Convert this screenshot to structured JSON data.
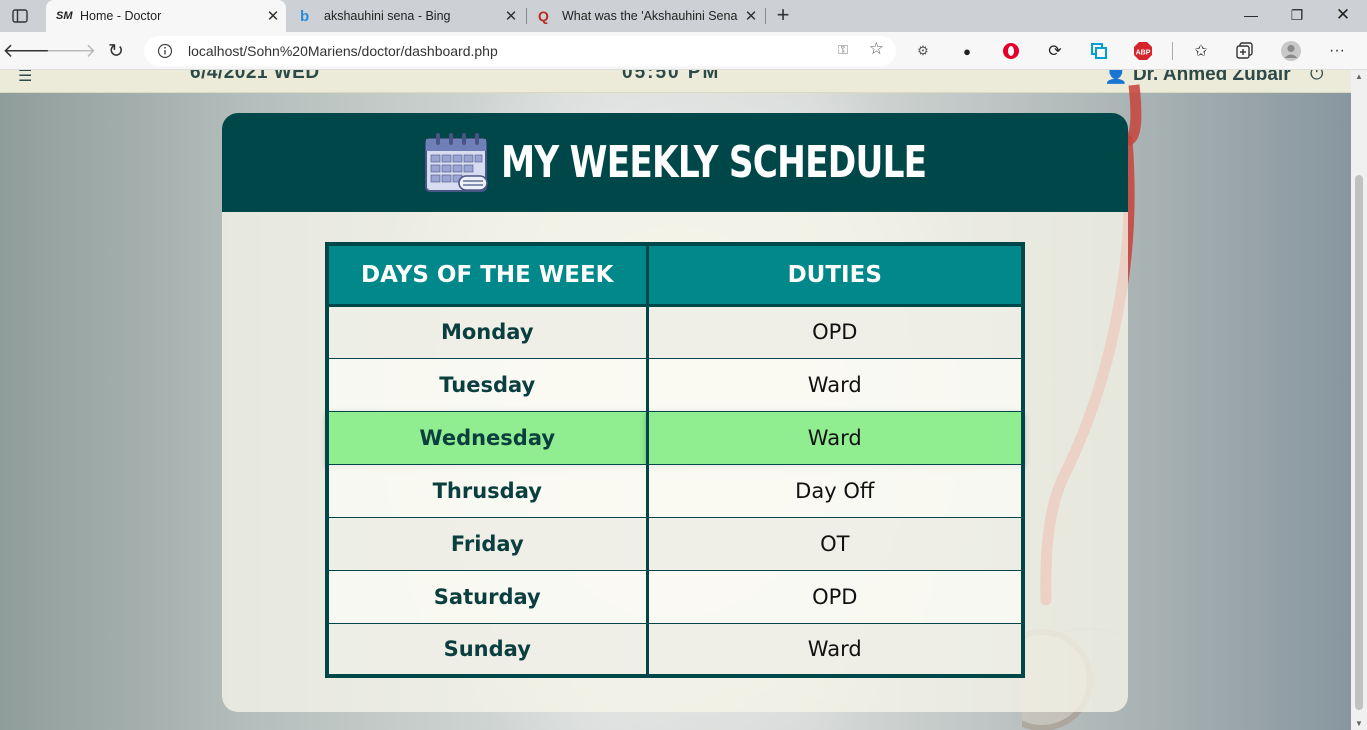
{
  "browser": {
    "tabs": [
      {
        "favicon_text": "SM",
        "title": "Home - Doctor",
        "active": true
      },
      {
        "favicon_text": "b",
        "title": "akshauhini sena - Bing",
        "active": false
      },
      {
        "favicon_text": "Q",
        "title": "What was the 'Akshauhini Sena' c",
        "active": false
      }
    ],
    "url": "localhost/Sohn%20Mariens/doctor/dashboard.php",
    "colors": {
      "bing_blue": "#2b8ed6",
      "quora_red": "#b92b27",
      "opera_red": "#e4002b",
      "abp_red": "#d4242c"
    }
  },
  "header": {
    "date": "6/4/2021 WED",
    "time": "05:50 PM",
    "user_name": "Dr. Ahmed Zubair"
  },
  "schedule": {
    "title": "MY WEEKLY SCHEDULE",
    "columns": [
      "DAYS OF THE WEEK",
      "DUTIES"
    ],
    "rows": [
      {
        "day": "Monday",
        "duty": "OPD"
      },
      {
        "day": "Tuesday",
        "duty": "Ward"
      },
      {
        "day": "Wednesday",
        "duty": "Ward",
        "highlighted": true
      },
      {
        "day": "Thrusday",
        "duty": "Day Off"
      },
      {
        "day": "Friday",
        "duty": "OT"
      },
      {
        "day": "Saturday",
        "duty": "OPD"
      },
      {
        "day": "Sunday",
        "duty": "Ward"
      }
    ],
    "colors": {
      "header_bg": "#00474a",
      "column_header_bg": "#00888a",
      "highlight_bg": "#90ee90"
    }
  }
}
